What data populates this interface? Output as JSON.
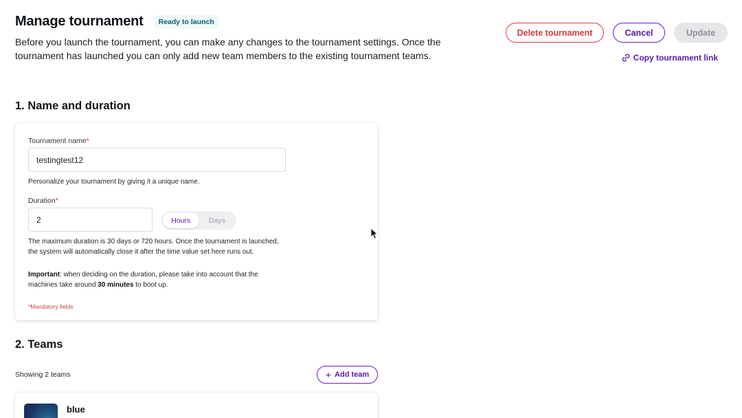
{
  "header": {
    "title": "Manage tournament",
    "status": "Ready to launch",
    "intro_line1": "Before you launch the tournament, you can make any changes to the tournament settings.",
    "intro_line2": "Once the tournament has launched you can only add new team members to the existing tournament teams."
  },
  "actions": {
    "delete_label": "Delete tournament",
    "cancel_label": "Cancel",
    "update_label": "Update",
    "copy_link_label": "Copy tournament link"
  },
  "section1": {
    "title": "1. Name and duration",
    "name_label": "Tournament name",
    "name_value": "testingtest12",
    "name_help": "Personalize your tournament by giving it a unique name.",
    "duration_label": "Duration",
    "duration_value": "2",
    "toggle_options": [
      "Hours",
      "Days"
    ],
    "toggle_selected": "Hours",
    "duration_help": "The maximum duration is 30 days or 720 hours. Once the tournament is launched, the system will automatically close it after the time value set here runs out.",
    "important_label": "Important",
    "important_text_1": ": when deciding on the duration, please take into account that the machines take around ",
    "important_bold": "30 minutes",
    "important_text_2": " to boot up.",
    "mandatory_note": "*Mandatory fields",
    "required_marker": "*"
  },
  "section2": {
    "title": "2. Teams",
    "count_text": "Showing 2 teams",
    "add_team_label": "Add team",
    "teams": [
      {
        "name": "blue"
      }
    ]
  },
  "colors": {
    "accent": "#5b17ad",
    "danger": "#d23b44",
    "badge_bg": "#eefaf8",
    "badge_text": "#0c5b76",
    "disabled_bg": "#e5e6e8"
  }
}
